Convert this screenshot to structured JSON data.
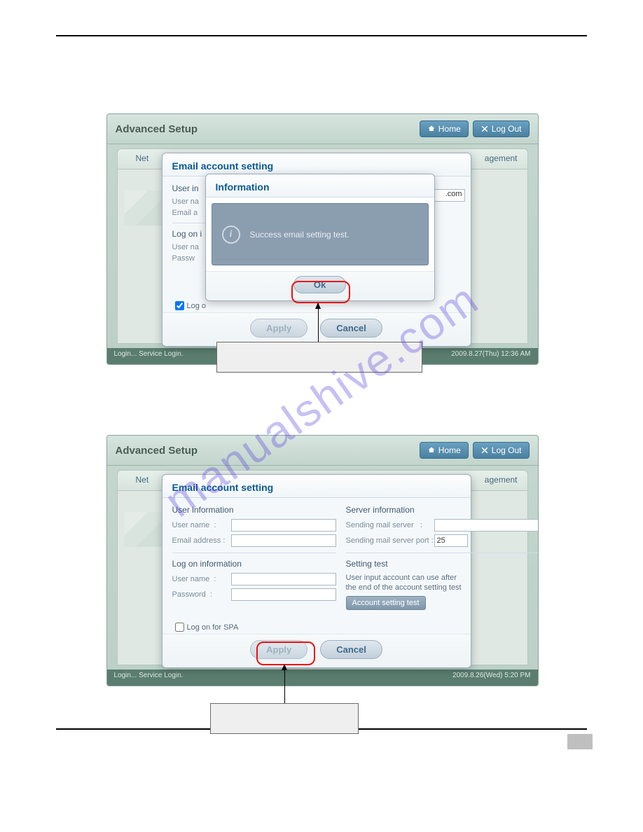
{
  "watermark": "manualshive.com",
  "app": {
    "title": "Advanced Setup",
    "homeLabel": "Home",
    "logoutLabel": "Log Out",
    "tabLeft": "Net",
    "tabRight": "agement",
    "statusLeft": "Login... Service Login.",
    "status1Right": "2009.8.27(Thu)  12:36 AM",
    "status2Right": "2009.8.26(Wed)  5:20 PM"
  },
  "bgLabels": {
    "userInfoShort": "User in",
    "userNameShort": "User na",
    "emailShort": "Email a",
    "logOnShort": "Log on i",
    "userNa2": "User na",
    "passwShort": "Passw",
    "spaShort": "Log o",
    "EShort": "E",
    "comSuffix": ".com"
  },
  "emailDialog": {
    "title": "Email account setting",
    "userInfo": "User information",
    "userName": "User name",
    "emailAddress": "Email address",
    "logOnInfo": "Log on information",
    "password": "Password",
    "serverInfo": "Server information",
    "sendingServer": "Sending mail server",
    "sendingPort": "Sending mail server port",
    "portValue": "25",
    "settingTest": "Setting test",
    "testNote1": "User input account can use after",
    "testNote2": "the end of the account setting test",
    "testBtn": "Account setting test",
    "logOnSPA": "Log on for SPA",
    "apply": "Apply",
    "cancel": "Cancel"
  },
  "infoDialog": {
    "title": "Information",
    "msg": "Success email setting test.",
    "ok": "Ok"
  }
}
